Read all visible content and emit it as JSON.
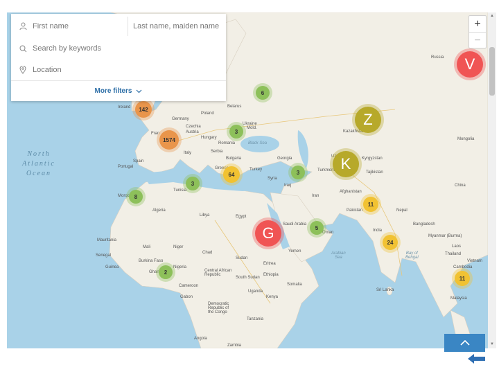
{
  "search": {
    "first_name_placeholder": "First name",
    "last_name_placeholder": "Last name, maiden name",
    "keywords_placeholder": "Search by keywords",
    "location_placeholder": "Location",
    "more_filters_label": "More filters"
  },
  "zoom": {
    "in_label": "+",
    "out_label": "−"
  },
  "map": {
    "ocean_labels": {
      "atlantic": "North\nAtlantic\nOcean"
    },
    "sea_labels": {
      "arabian": "Arabian\nSea",
      "bengal": "Bay of\nBengal",
      "black": "Black Sea"
    },
    "country_labels": {
      "russia": "Russia",
      "belarus": "Belarus",
      "ireland": "Ireland",
      "poland": "Poland",
      "germany": "Germany",
      "ukraine": "Ukraine",
      "czechia": "Czechia",
      "moldova": "Mold.",
      "france": "Fran",
      "austria": "Austria",
      "hungary": "Hungary",
      "romania": "Romania",
      "italy": "Italy",
      "serbia": "Serbia",
      "bulgaria": "Bulgaria",
      "spain": "Spain",
      "portugal": "Portugal",
      "greece": "Greece",
      "turkey": "Turkey",
      "georgia": "Georgia",
      "kazakhstan": "Kazakhstan",
      "uzbekistan": "Uzbekistan",
      "kyrgyzstan": "Kyrgyzstan",
      "turkmenistan": "Turkmenistan",
      "tajikistan": "Tajikistan",
      "mongolia": "Mongolia",
      "china": "China",
      "syria": "Syria",
      "iraq": "Iraq",
      "iran": "Iran",
      "afghanistan": "Afghanistan",
      "pakistan": "Pakistan",
      "nepal": "Nepal",
      "india": "India",
      "bangladesh": "Bangladesh",
      "myanmar": "Myanmar (Burma)",
      "laos": "Laos",
      "thailand": "Thailand",
      "vietnam": "Vietnam",
      "cambodia": "Cambodia",
      "sri_lanka": "Sri Lanka",
      "malaysia": "Malaysia",
      "tunisia": "Tunisia",
      "morocco": "Morocco",
      "algeria": "Algeria",
      "libya": "Libya",
      "egypt": "Egypt",
      "saudi": "Saudi Arabia",
      "oman": "Oman",
      "yemen": "Yemen",
      "mauritania": "Mauritania",
      "mali": "Mali",
      "niger": "Niger",
      "chad": "Chad",
      "sudan": "Sudan",
      "eritrea": "Eritrea",
      "ethiopia": "Ethiopia",
      "somalia": "Somalia",
      "senegal": "Senegal",
      "nigeria": "Nigeria",
      "ghana": "Ghana",
      "cameroon": "Cameroon",
      "gabon": "Gabon",
      "south_sudan": "South Sudan",
      "kenya": "Kenya",
      "drc": "Democratic\nRepublic of\nthe Congo",
      "tanzania": "Tanzania",
      "angola": "Angola",
      "zambia": "Zambia",
      "guinea": "Guinea",
      "burkina": "Burkina Faso",
      "uganda": "Uganda",
      "car": "Central African\nRepublic"
    }
  },
  "clusters": [
    {
      "id": "c6",
      "label": "6",
      "color": "green"
    },
    {
      "id": "c142",
      "label": "142",
      "color": "orange"
    },
    {
      "id": "c1574",
      "label": "1574",
      "color": "orange"
    },
    {
      "id": "c3a",
      "label": "3",
      "color": "green"
    },
    {
      "id": "c64",
      "label": "64",
      "color": "yellow"
    },
    {
      "id": "c3b",
      "label": "3",
      "color": "green"
    },
    {
      "id": "c3c",
      "label": "3",
      "color": "green"
    },
    {
      "id": "c8",
      "label": "8",
      "color": "green"
    },
    {
      "id": "c11a",
      "label": "11",
      "color": "yellow"
    },
    {
      "id": "c5",
      "label": "5",
      "color": "green"
    },
    {
      "id": "c24",
      "label": "24",
      "color": "yellow"
    },
    {
      "id": "c2",
      "label": "2",
      "color": "green"
    },
    {
      "id": "c11b",
      "label": "11",
      "color": "yellow"
    }
  ],
  "letter_markers": [
    {
      "id": "V",
      "label": "V",
      "color": "red"
    },
    {
      "id": "Z",
      "label": "Z",
      "color": "olive"
    },
    {
      "id": "K",
      "label": "K",
      "color": "olive"
    },
    {
      "id": "G",
      "label": "G",
      "color": "red"
    }
  ],
  "colors": {
    "water": "#a9d2e8",
    "land": "#f2efe6",
    "cluster_green": "#8dc05a",
    "cluster_yellow": "#f1c232",
    "cluster_orange": "#e9954b",
    "marker_red": "#f05454",
    "marker_olive": "#b7a92a",
    "accent_blue": "#3a86c4"
  },
  "icons": {
    "person": "person-icon",
    "search": "search-icon",
    "location": "location-pin-icon",
    "chevron": "chevron-down-icon",
    "back_top": "chevron-up-icon",
    "back": "back-arrow-icon"
  }
}
